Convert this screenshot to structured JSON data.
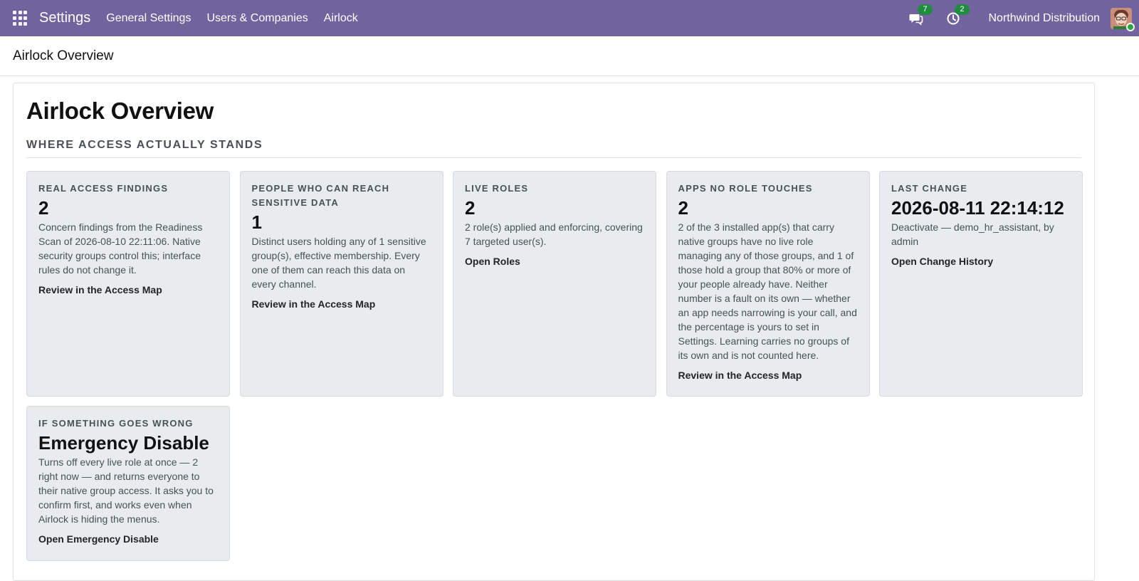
{
  "navbar": {
    "brand": "Settings",
    "menu": [
      "General Settings",
      "Users & Companies",
      "Airlock"
    ],
    "messages_count": "7",
    "activities_count": "2",
    "company": "Northwind Distribution",
    "bg_color": "#71639e",
    "badge_color": "#1f8c3f"
  },
  "breadcrumb": "Airlock Overview",
  "page": {
    "title": "Airlock Overview",
    "section": "WHERE ACCESS ACTUALLY STANDS"
  },
  "cards": [
    {
      "label": "REAL ACCESS FINDINGS",
      "value": "2",
      "desc": "Concern findings from the Readiness Scan of 2026-08-10 22:11:06. Native security groups control this; interface rules do not change it.",
      "link": "Review in the Access Map"
    },
    {
      "label": "PEOPLE WHO CAN REACH SENSITIVE DATA",
      "value": "1",
      "desc": "Distinct users holding any of 1 sensitive group(s), effective membership. Every one of them can reach this data on every channel.",
      "link": "Review in the Access Map"
    },
    {
      "label": "LIVE ROLES",
      "value": "2",
      "desc": "2 role(s) applied and enforcing, covering 7 targeted user(s).",
      "link": "Open Roles"
    },
    {
      "label": "APPS NO ROLE TOUCHES",
      "value": "2",
      "desc": "2 of the 3 installed app(s) that carry native groups have no live role managing any of those groups, and 1 of those hold a group that 80% or more of your people already have. Neither number is a fault on its own — whether an app needs narrowing is your call, and the percentage is yours to set in Settings. Learning carries no groups of its own and is not counted here.",
      "link": "Review in the Access Map"
    },
    {
      "label": "LAST CHANGE",
      "value": "2026-08-11 22:14:12",
      "desc": "Deactivate — demo_hr_assistant, by admin",
      "link": "Open Change History"
    },
    {
      "label": "IF SOMETHING GOES WRONG",
      "value": "Emergency Disable",
      "desc": "Turns off every live role at once — 2 right now — and returns everyone to their native group access. It asks you to confirm first, and works even when Airlock is hiding the menus.",
      "link": "Open Emergency Disable"
    }
  ]
}
